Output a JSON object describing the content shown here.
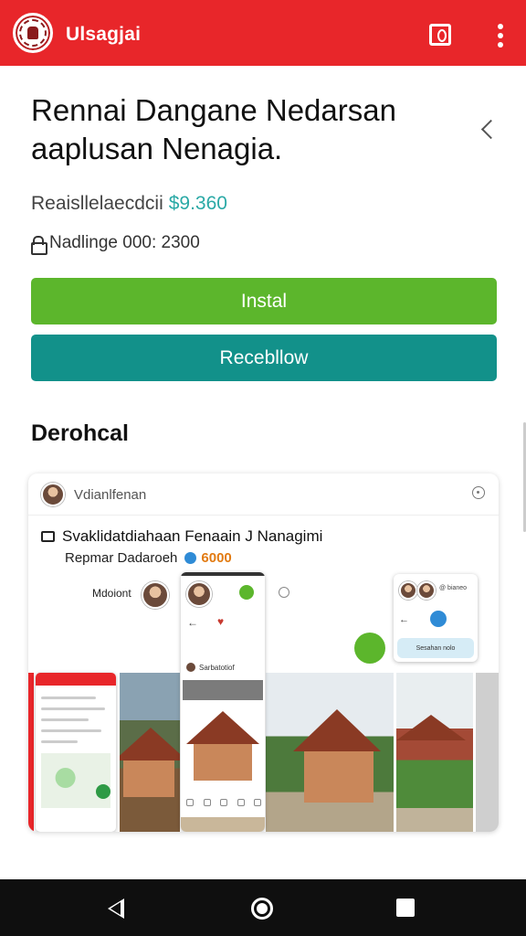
{
  "app_bar": {
    "title": "Ulsagjai",
    "logo_icon": "seal-logo-icon",
    "share_icon": "share-icon",
    "more_icon": "more-vert-icon",
    "color": "#e8262a"
  },
  "listing": {
    "headline": "Rennai Dangane Nedarsan aaplusan Nenagia.",
    "price_label": "Reaisllelaecdcii",
    "price_value": "$9.360",
    "rating_label": "Nadlinge 000: 2300",
    "install_label": "Instal",
    "secondary_label": "Recebllow",
    "install_color": "#5cb62c",
    "secondary_color": "#12918a"
  },
  "section": {
    "title": "Derohcal"
  },
  "preview_card": {
    "author_name": "Vdianlfenan",
    "line1": "Svaklidatdiahaan Fenaain J Nanagimi",
    "line2_label": "Repmar Dadaroeh",
    "line2_score": "6000",
    "author_label": "Mdoiont",
    "mock_center_row": "Sarbatotiof",
    "mock_right_label": "@ bianeo",
    "mock_right_pill": "Sesahan nolo"
  },
  "system_nav": {
    "back_icon": "back-triangle-icon",
    "home_icon": "home-circle-icon",
    "recent_icon": "recent-square-icon"
  }
}
